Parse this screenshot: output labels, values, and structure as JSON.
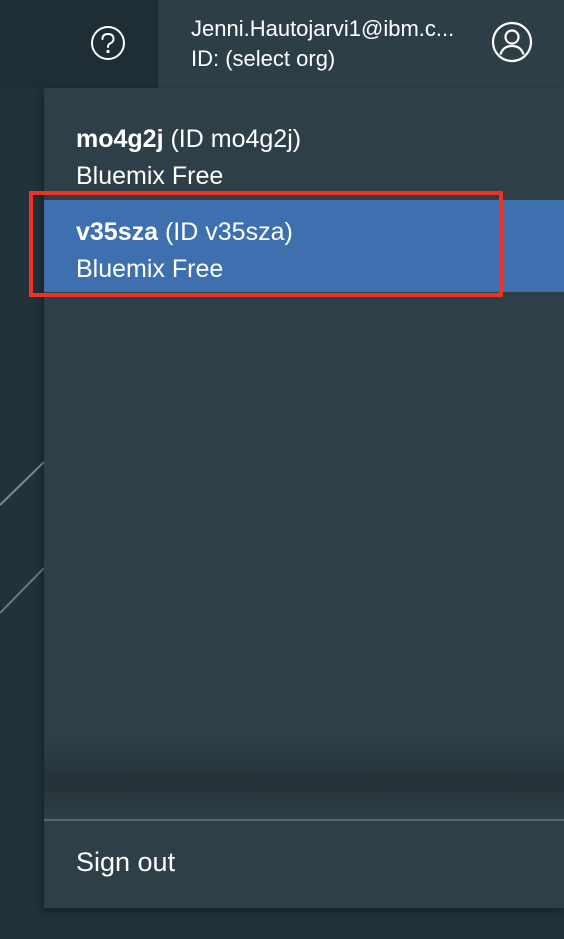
{
  "header": {
    "help_icon": "help-circle-icon",
    "user_email": "Jenni.Hautojarvi1@ibm.c...",
    "user_id": "ID: (select org)",
    "avatar_icon": "user-avatar-icon"
  },
  "orgs": [
    {
      "name": "mo4g2j",
      "id_text": "(ID mo4g2j)",
      "plan": "Bluemix Free",
      "selected": false
    },
    {
      "name": "v35sza",
      "id_text": "(ID v35sza)",
      "plan": "Bluemix Free",
      "selected": true
    }
  ],
  "menu": {
    "signout_label": "Sign out"
  },
  "colors": {
    "selected_bg": "#3e70b0",
    "annotation_border": "#ee3322",
    "panel_bg": "#2f3f47",
    "header_bg": "#2e3e46"
  }
}
